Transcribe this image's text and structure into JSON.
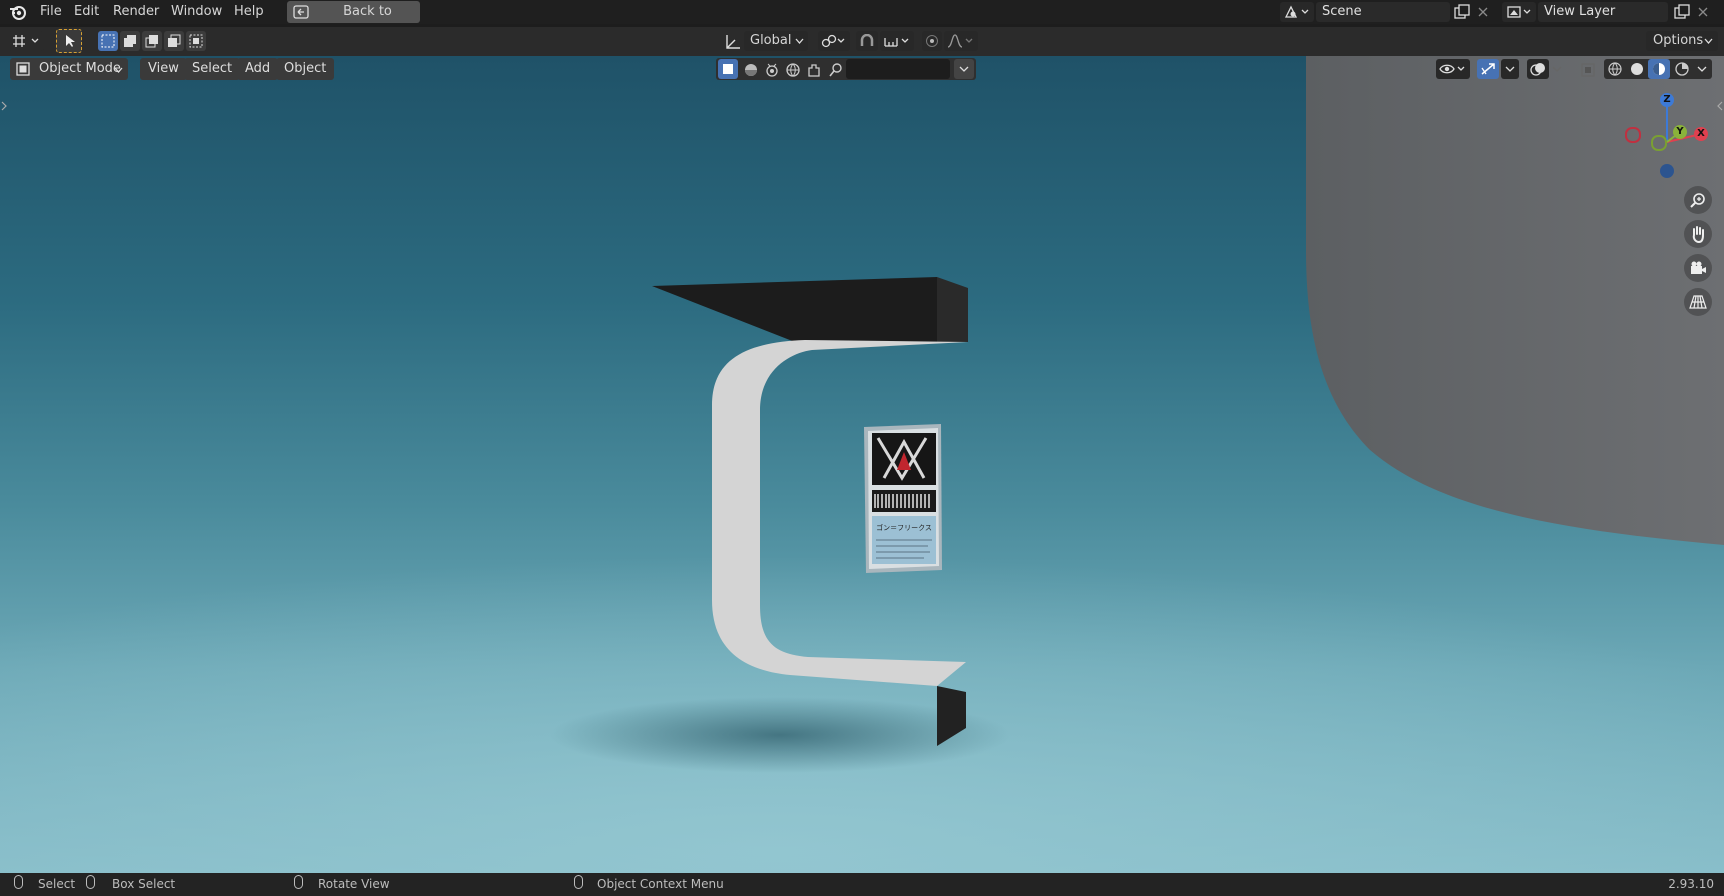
{
  "menubar": {
    "items": [
      "File",
      "Edit",
      "Render",
      "Window",
      "Help"
    ],
    "back_button": "Back to Previous",
    "scene_label": "Scene",
    "view_layer_label": "View Layer"
  },
  "tool_header": {
    "orientation": "Global",
    "options_label": "Options"
  },
  "viewport_header": {
    "mode": "Object Mode",
    "menus": [
      "View",
      "Select",
      "Add",
      "Object"
    ]
  },
  "gizmo": {
    "x": "X",
    "y": "Y",
    "z": "Z"
  },
  "id_card": {
    "caption": "ゴン＝フリークス"
  },
  "statusbar": {
    "select": "Select",
    "box_select": "Box Select",
    "rotate_view": "Rotate View",
    "context_menu": "Object Context Menu",
    "version": "2.93.10"
  },
  "colors": {
    "accent": "#4772b3",
    "viewport_top": "#1f5268",
    "viewport_bottom": "#86bcc8",
    "gizmo_x": "#e0404f",
    "gizmo_y": "#8ab33a",
    "gizmo_z": "#3d7ad6"
  }
}
